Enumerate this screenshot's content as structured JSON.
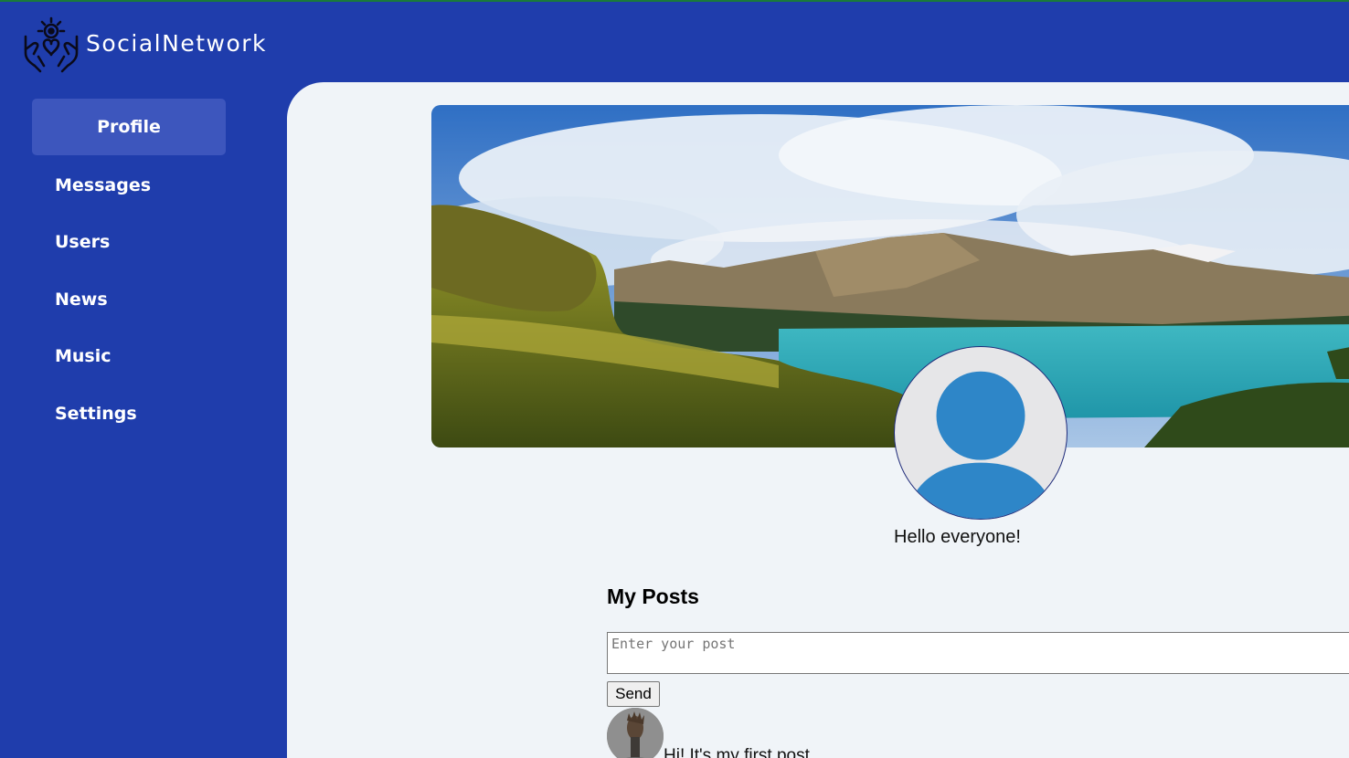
{
  "header": {
    "brand": "SocialNetwork",
    "logo_icon": "charity-hands-icon"
  },
  "sidebar": {
    "items": [
      {
        "label": "Profile",
        "active": true
      },
      {
        "label": "Messages",
        "active": false
      },
      {
        "label": "Users",
        "active": false
      },
      {
        "label": "News",
        "active": false
      },
      {
        "label": "Music",
        "active": false
      },
      {
        "label": "Settings",
        "active": false
      }
    ]
  },
  "profile": {
    "status": "Hello everyone!",
    "avatar_icon": "default-user-avatar-icon"
  },
  "posts": {
    "title": "My Posts",
    "input_placeholder": "Enter your post",
    "input_value": "",
    "send_label": "Send",
    "items": [
      {
        "text": "Hi! It's my first post"
      }
    ]
  },
  "colors": {
    "primary": "#1f3dac",
    "active_nav": "#3d56bd",
    "content_bg": "#f0f4f8",
    "avatar_blue": "#2e86c8"
  }
}
